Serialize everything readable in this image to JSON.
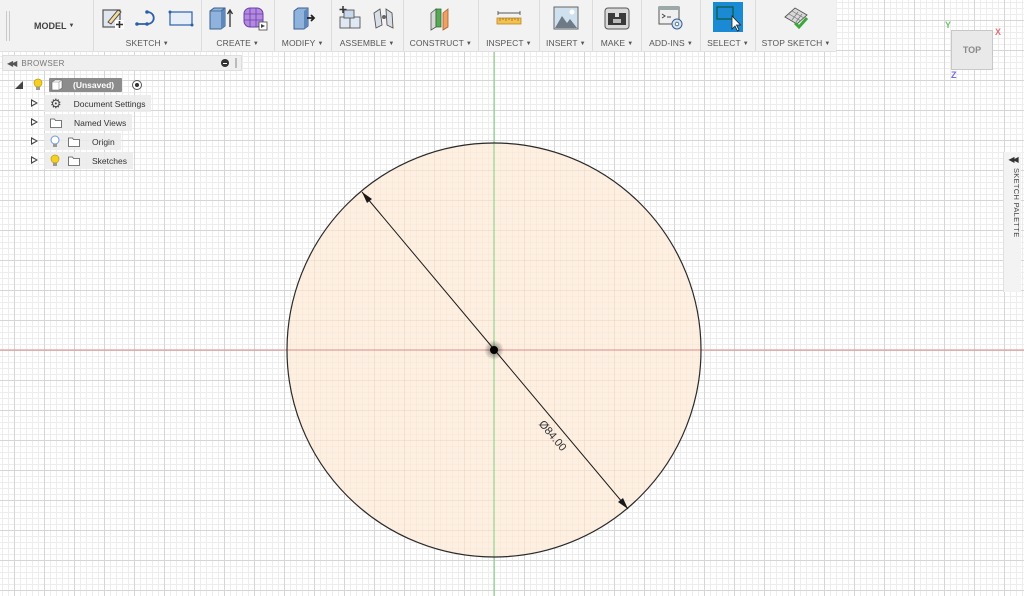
{
  "toolbar": {
    "workspace": "MODEL",
    "groups": [
      {
        "label": "SKETCH",
        "icons": [
          "create-sketch-icon",
          "spline-icon",
          "rectangle-icon"
        ]
      },
      {
        "label": "CREATE",
        "icons": [
          "extrude-icon",
          "form-icon"
        ]
      },
      {
        "label": "MODIFY",
        "icons": [
          "press-pull-icon"
        ]
      },
      {
        "label": "ASSEMBLE",
        "icons": [
          "new-component-icon",
          "joint-icon"
        ]
      },
      {
        "label": "CONSTRUCT",
        "icons": [
          "offset-plane-icon"
        ]
      },
      {
        "label": "INSPECT",
        "icons": [
          "measure-icon"
        ]
      },
      {
        "label": "INSERT",
        "icons": [
          "insert-image-icon"
        ]
      },
      {
        "label": "MAKE",
        "icons": [
          "3d-print-icon"
        ]
      },
      {
        "label": "ADD-INS",
        "icons": [
          "scripts-addins-icon"
        ]
      },
      {
        "label": "SELECT",
        "icons": [
          "select-icon"
        ]
      },
      {
        "label": "STOP SKETCH",
        "icons": [
          "stop-sketch-icon"
        ]
      }
    ]
  },
  "browser": {
    "title": "BROWSER",
    "root": "(Unsaved)",
    "items": [
      {
        "label": "Document Settings",
        "icon": "gear-icon",
        "bulb": false
      },
      {
        "label": "Named Views",
        "icon": "folder-icon",
        "bulb": false
      },
      {
        "label": "Origin",
        "icon": "folder-icon",
        "bulb": true,
        "bulb_color": "#8fb8e8"
      },
      {
        "label": "Sketches",
        "icon": "folder-icon",
        "bulb": true,
        "bulb_color": "#f5d020"
      }
    ]
  },
  "viewcube": {
    "face": "TOP",
    "axes": {
      "x": "X",
      "y": "Y",
      "z": "Z"
    },
    "axis_colors": {
      "x": "#e07070",
      "y": "#70c070",
      "z": "#7070e0"
    }
  },
  "sketch_palette": {
    "label": "SKETCH PALETTE"
  },
  "sketch": {
    "dimension_text": "Ø84.00",
    "circle_fill": "#fdf0e2",
    "axis_colors": {
      "x_axis": "#e08a8a",
      "y_axis": "#7ccf7c"
    }
  },
  "colors": {
    "select_accent": "#1a8ad4",
    "unsaved_pill": "#8c8c8c",
    "toolbar_bg": "#f2f2f2"
  }
}
